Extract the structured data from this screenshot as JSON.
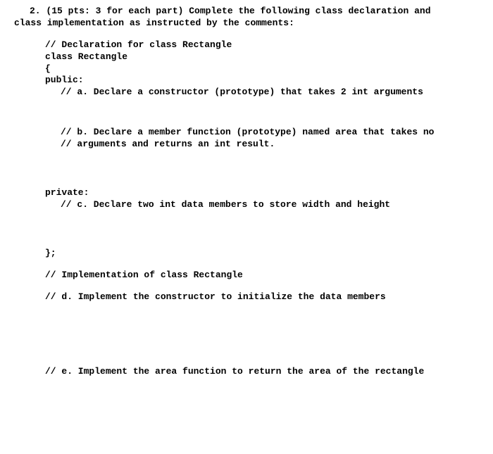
{
  "intro": {
    "line1": "2. (15 pts: 3 for each part) Complete the following class declaration and",
    "line2": "class implementation as instructed by the comments:"
  },
  "code": {
    "decl_comment": "// Declaration for class Rectangle",
    "class_line": "class Rectangle",
    "open_brace": "{",
    "public_line": "public:",
    "part_a": "// a. Declare a constructor (prototype) that takes 2 int arguments",
    "part_b_l1": "// b. Declare a member function (prototype) named area that takes no",
    "part_b_l2": "//    arguments and returns an int result.",
    "private_line": "private:",
    "part_c": "// c. Declare two int data members to store width and height",
    "close_brace": "};",
    "impl_comment": "// Implementation of class Rectangle",
    "part_d": "// d. Implement the constructor to initialize the data members",
    "part_e": "// e. Implement the area function to return the area of the rectangle"
  }
}
